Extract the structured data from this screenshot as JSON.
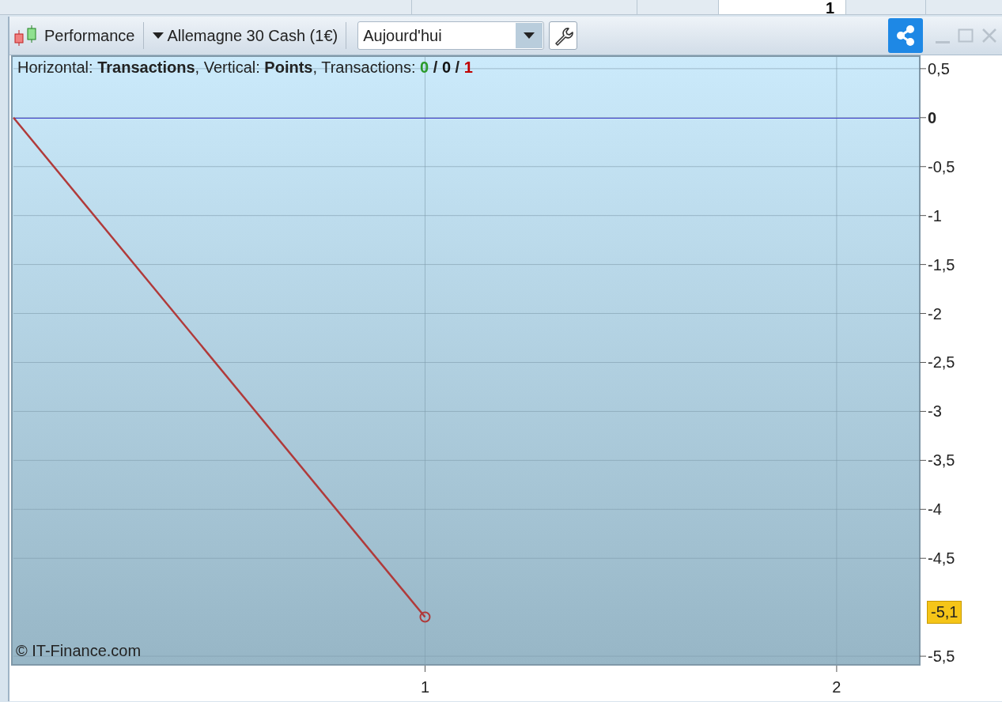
{
  "background_window": {
    "cell_text": "1"
  },
  "toolbar": {
    "title": "Performance",
    "instrument": "Allemagne 30 Cash (1€)",
    "period": {
      "value": "Aujourd'hui"
    }
  },
  "chart": {
    "caption": "Horizontal: **Transactions**, Vertical: **Points**, Transactions: ",
    "counts": [
      {
        "text": "0",
        "color": "#2a9a2a"
      },
      {
        "text": "0",
        "color": "#111111"
      },
      {
        "text": "1",
        "color": "#c00000"
      }
    ],
    "counts_separator": " / ",
    "copyright": "© IT-Finance.com",
    "last_value_label": "-5,1",
    "chart_data": {
      "type": "line",
      "x": [
        0,
        1
      ],
      "series": [
        {
          "color": "#b03a3a",
          "values": [
            0,
            -5.1
          ]
        }
      ],
      "grid": true,
      "ref_lines": [
        {
          "axis": "y",
          "value": 0,
          "color": "#3a3ac8"
        }
      ],
      "xlim": [
        0,
        2.2
      ],
      "ylim": [
        -5.58,
        0.62
      ],
      "xticks": [
        1,
        2
      ],
      "yticks": [
        {
          "value": 0.5,
          "label": "0,5"
        },
        {
          "value": 0,
          "label": "0"
        },
        {
          "value": -0.5,
          "label": "-0,5"
        },
        {
          "value": -1,
          "label": "-1"
        },
        {
          "value": -1.5,
          "label": "-1,5"
        },
        {
          "value": -2,
          "label": "-2"
        },
        {
          "value": -2.5,
          "label": "-2,5"
        },
        {
          "value": -3,
          "label": "-3"
        },
        {
          "value": -3.5,
          "label": "-3,5"
        },
        {
          "value": -4,
          "label": "-4"
        },
        {
          "value": -4.5,
          "label": "-4,5"
        },
        {
          "value": -5.5,
          "label": "-5,5"
        }
      ]
    }
  }
}
